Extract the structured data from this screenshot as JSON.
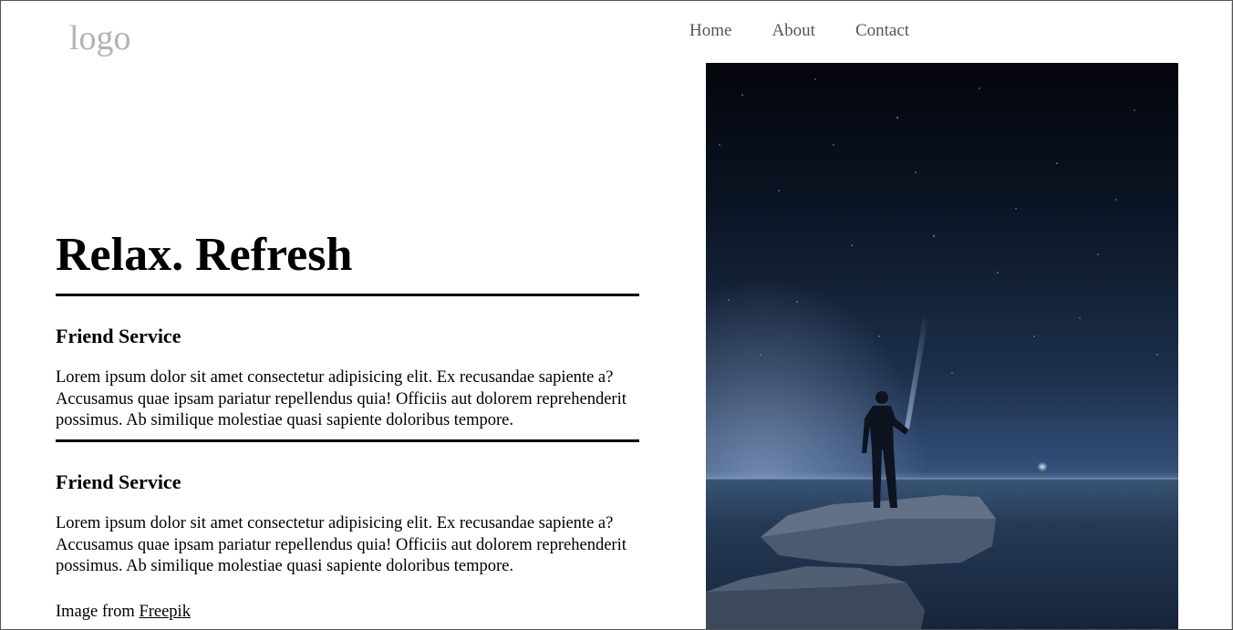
{
  "header": {
    "logo": "logo",
    "nav": [
      {
        "label": "Home"
      },
      {
        "label": "About"
      },
      {
        "label": "Contact"
      }
    ]
  },
  "main": {
    "title": "Relax. Refresh",
    "sections": [
      {
        "heading": "Friend Service",
        "text": "Lorem ipsum dolor sit amet consectetur adipisicing elit. Ex recusandae sapiente a? Accusamus quae ipsam pariatur repellendus quia! Officiis aut dolorem reprehenderit possimus. Ab similique molestiae quasi sapiente doloribus tempore."
      },
      {
        "heading": "Friend Service",
        "text": "Lorem ipsum dolor sit amet consectetur adipisicing elit. Ex recusandae sapiente a? Accusamus quae ipsam pariatur repellendus quia! Officiis aut dolorem reprehenderit possimus. Ab similique molestiae quasi sapiente doloribus tempore."
      }
    ],
    "credit": {
      "prefix": "Image from ",
      "link_label": "Freepik"
    }
  },
  "colors": {
    "logo": "#b3b3b3",
    "nav_text": "#555555",
    "rule": "#000000",
    "sky_top": "#03060d",
    "sky_horizon": "#3e5a80",
    "sea": "#23364f"
  }
}
